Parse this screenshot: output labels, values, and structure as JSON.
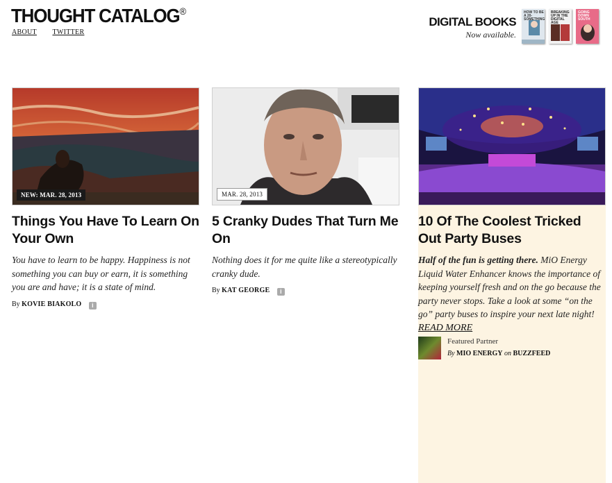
{
  "header": {
    "logo": "THOUGHT CATALOG",
    "logo_mark": "®",
    "nav": [
      "ABOUT",
      "TWITTER"
    ],
    "promo_title": "DIGITAL BOOKS",
    "promo_subtitle": "Now available.",
    "books": [
      {
        "label": "HOW TO BE A 20-SOMETHING",
        "color": "#d9e3ea"
      },
      {
        "label": "BREAKING UP IN THE DIGITAL AGE",
        "color": "#f2f2f2"
      },
      {
        "label": "GOING DOWN SOUTH",
        "color": "#e56e8a"
      }
    ]
  },
  "articles": [
    {
      "date": "NEW: MAR. 28, 2013",
      "title": "Things You Have To Learn On Your Own",
      "excerpt": "You have to learn to be happy. Happiness is not something you can buy or earn, it is something you are and have; it is a state of mind.",
      "by": "By",
      "author": "KOVIE BIAKOLO"
    },
    {
      "date": "MAR. 28, 2013",
      "title": "5 Cranky Dudes That Turn Me On",
      "excerpt": "Nothing does it for me quite like a stereotypically cranky dude.",
      "by": "By",
      "author": "KAT GEORGE"
    },
    {
      "title": "10 Of The Coolest Tricked Out Party Buses",
      "excerpt_lead": "Half of the fun is getting there.",
      "excerpt": " MiO Energy Liquid Water Enhancer knows the importance of keeping yourself fresh and on the go because the party never stops. Take a look at some “on the go” party buses to inspire your next late night!",
      "read_more": "READ MORE",
      "partner_label": "Featured Partner",
      "by": "By",
      "author": "MIO ENERGY",
      "on": "on",
      "site": "BUZZFEED"
    }
  ],
  "info_icon": "i",
  "colors": {
    "sponsored_bg": "#fdf4e2"
  }
}
